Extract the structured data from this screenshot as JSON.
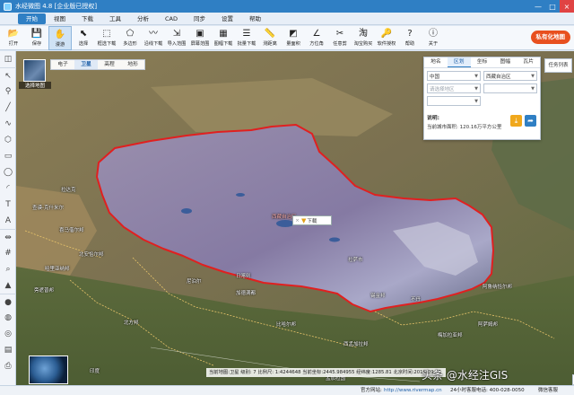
{
  "window": {
    "title": "水经微图 4.8 [企业版已授权]",
    "controls": [
      "—",
      "□",
      "×"
    ]
  },
  "menu": {
    "items": [
      "开始",
      "视图",
      "下载",
      "工具",
      "分析",
      "CAD",
      "同步",
      "设置",
      "帮助"
    ],
    "active_index": 0
  },
  "toolbar": {
    "tools": [
      {
        "label": "打开",
        "icon": "folder-icon",
        "glyph": "📂"
      },
      {
        "label": "保存",
        "icon": "save-icon",
        "glyph": "💾"
      },
      {
        "label": "漫游",
        "icon": "hand-icon",
        "glyph": "✋"
      },
      {
        "label": "选择",
        "icon": "cursor-icon",
        "glyph": "⬉"
      },
      {
        "label": "框选下载",
        "icon": "rect-select-icon",
        "glyph": "⬚"
      },
      {
        "label": "多边形",
        "icon": "polygon-icon",
        "glyph": "⬠"
      },
      {
        "label": "沿线下载",
        "icon": "polyline-icon",
        "glyph": "〰"
      },
      {
        "label": "导入范围",
        "icon": "import-icon",
        "glyph": "⇲"
      },
      {
        "label": "屏幕范围",
        "icon": "screen-icon",
        "glyph": "▣"
      },
      {
        "label": "图幅下载",
        "icon": "sheet-icon",
        "glyph": "▦"
      },
      {
        "label": "批量下载",
        "icon": "batch-icon",
        "glyph": "☰"
      },
      {
        "label": "测距离",
        "icon": "ruler-icon",
        "glyph": "📏"
      },
      {
        "label": "量面积",
        "icon": "area-icon",
        "glyph": "◩"
      },
      {
        "label": "方位角",
        "icon": "azimuth-icon",
        "glyph": "∠"
      },
      {
        "label": "任意剪",
        "icon": "scissors-icon",
        "glyph": "✂"
      },
      {
        "label": "淘宝购买",
        "icon": "taobao-icon",
        "glyph": "淘"
      },
      {
        "label": "软件授权",
        "icon": "license-icon",
        "glyph": "🔑"
      },
      {
        "label": "帮助",
        "icon": "help-icon",
        "glyph": "?"
      },
      {
        "label": "关于",
        "icon": "info-icon",
        "glyph": "ⓘ"
      }
    ],
    "active_index": 2,
    "private_map_label": "私有化地图"
  },
  "left_tools": [
    {
      "icon": "layers-icon",
      "glyph": "◫"
    },
    {
      "icon": "cursor-icon",
      "glyph": "↖"
    },
    {
      "icon": "pin-icon",
      "glyph": "⚲"
    },
    {
      "icon": "line-icon",
      "glyph": "╱"
    },
    {
      "icon": "curve-icon",
      "glyph": "∿"
    },
    {
      "icon": "polygon-icon",
      "glyph": "⬡"
    },
    {
      "icon": "rect-icon",
      "glyph": "▭"
    },
    {
      "icon": "circle-icon",
      "glyph": "◯"
    },
    {
      "icon": "arc-icon",
      "glyph": "◜"
    },
    {
      "icon": "text-icon",
      "glyph": "T"
    },
    {
      "icon": "label-icon",
      "glyph": "A"
    },
    {
      "icon": "measure-icon",
      "glyph": "⇹"
    },
    {
      "icon": "grid-icon",
      "glyph": "#"
    },
    {
      "icon": "search-icon",
      "glyph": "⌕"
    },
    {
      "icon": "terrain-icon",
      "glyph": "▲"
    },
    {
      "icon": "color-icon",
      "glyph": "●"
    },
    {
      "icon": "globe-icon",
      "glyph": "◍"
    },
    {
      "icon": "target-icon",
      "glyph": "◎"
    },
    {
      "icon": "table-icon",
      "glyph": "▤"
    },
    {
      "icon": "print-icon",
      "glyph": "⎙"
    }
  ],
  "map": {
    "hybrid_thumb_label": "选择地图",
    "type_tabs": [
      "电子",
      "卫星",
      "高程",
      "地形"
    ],
    "active_type_index": 1,
    "popup": {
      "close": "×",
      "download": "下载"
    },
    "labels": [
      {
        "text": "西藏自治区",
        "red": true
      },
      {
        "text": "拉萨市"
      },
      {
        "text": "日喀则"
      },
      {
        "text": "尼泊尔"
      },
      {
        "text": "加德满都"
      },
      {
        "text": "比哈尔邦"
      },
      {
        "text": "印度"
      },
      {
        "text": "北方邦"
      },
      {
        "text": "喜马偕尔邦"
      },
      {
        "text": "北安恰尔邦"
      },
      {
        "text": "哈里亚纳邦"
      },
      {
        "text": "不丹"
      },
      {
        "text": "锡金邦"
      },
      {
        "text": "阿鲁纳恰尔邦"
      },
      {
        "text": "阿萨姆邦"
      },
      {
        "text": "梅加拉亚邦"
      },
      {
        "text": "西孟加拉邦"
      },
      {
        "text": "孟加拉国"
      },
      {
        "text": "查谟-克什米尔"
      },
      {
        "text": "拉达克"
      },
      {
        "text": "旁遮普邦"
      }
    ],
    "nav_controls": [
      "+",
      "−",
      "⌂"
    ]
  },
  "panel": {
    "tabs": [
      "地名",
      "区划",
      "坐标",
      "图幅",
      "瓦片"
    ],
    "active_tab_index": 1,
    "country": "中国",
    "province": "西藏自治区",
    "city_placeholder": "请选择地区",
    "note_title": "说明:",
    "note": "当前城市面积: 120.16万平方公里"
  },
  "task_list_label": "任务列表",
  "status": {
    "text": "当前地图:卫星  级别: 7  比例尺: 1:4244648  当前坐标:2445.984955  经纬度:1285.81  北京时间:2019-09-01"
  },
  "bottom": {
    "site_label": "官方网站:",
    "site_url": "http://www.rivermap.cn",
    "hotline": "24小时客服电话: 400-028-0050",
    "wechat": "微信客服"
  },
  "watermark": "头条 @水经注GIS",
  "colors": {
    "accent": "#2f7fc4",
    "boundary": "#e02020",
    "private_btn": "#e8501f"
  }
}
